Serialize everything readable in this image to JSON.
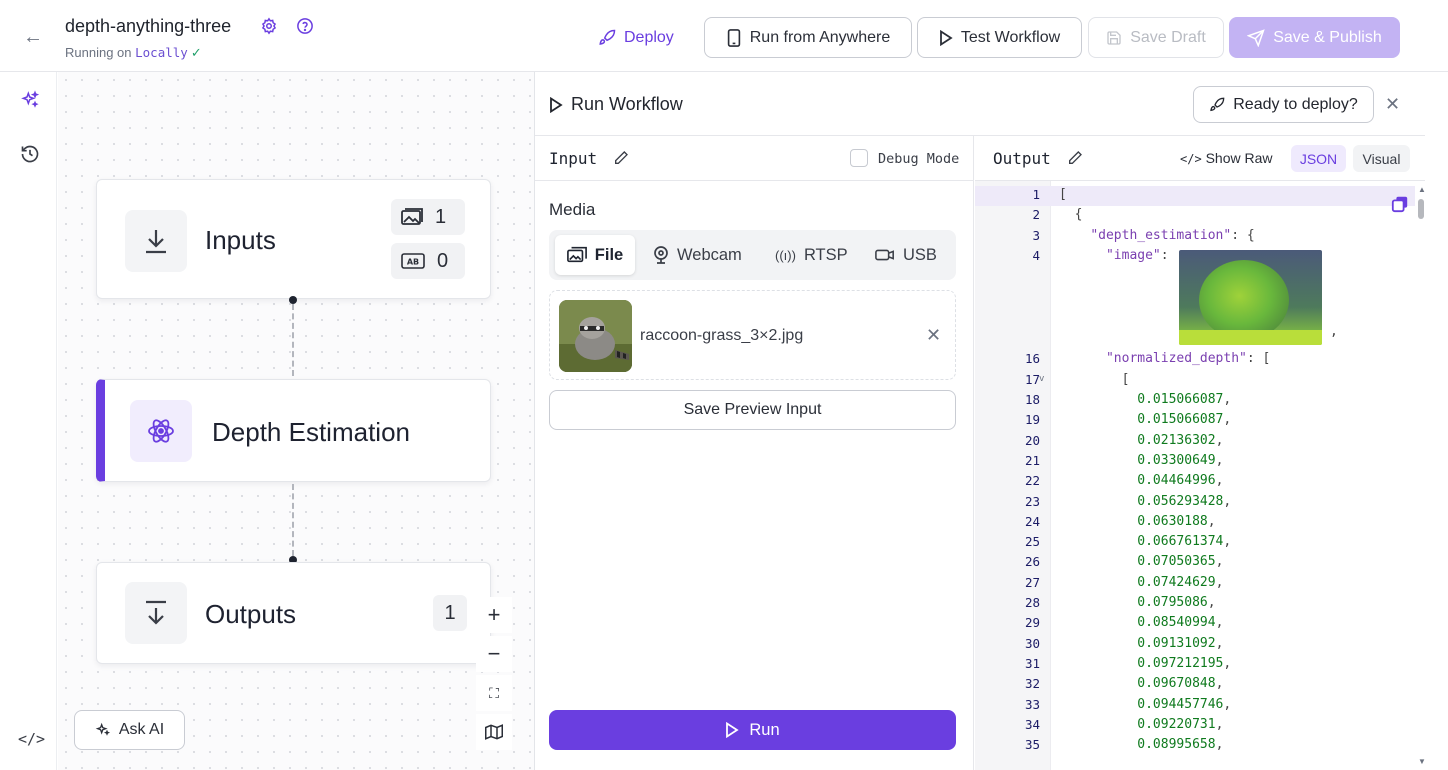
{
  "header": {
    "project_name": "depth-anything-three",
    "running_prefix": "Running on",
    "running_location": "Locally",
    "deploy_label": "Deploy",
    "run_anywhere_label": "Run from Anywhere",
    "test_workflow_label": "Test Workflow",
    "save_draft_label": "Save Draft",
    "save_publish_label": "Save & Publish"
  },
  "canvas": {
    "inputs_node": {
      "title": "Inputs",
      "image_count": "1",
      "text_count": "0"
    },
    "depth_node": {
      "title": "Depth Estimation"
    },
    "outputs_node": {
      "title": "Outputs",
      "count": "1"
    },
    "ask_ai_label": "Ask AI"
  },
  "panel": {
    "title": "Run Workflow",
    "ready_deploy_label": "Ready to deploy?",
    "input_label": "Input",
    "debug_label": "Debug Mode",
    "media_label": "Media",
    "media_tabs": [
      "File",
      "Webcam",
      "RTSP",
      "USB"
    ],
    "file_name": "raccoon-grass_3×2.jpg",
    "save_preview_label": "Save Preview Input",
    "run_label": "Run",
    "output_label": "Output",
    "show_raw_label": "Show Raw",
    "json_label": "JSON",
    "visual_label": "Visual"
  },
  "code": {
    "lines": [
      {
        "n": "1",
        "text": "["
      },
      {
        "n": "2",
        "text": "  {"
      },
      {
        "n": "3",
        "key": "\"depth_estimation\"",
        "rest": ": {",
        "indent": "    "
      },
      {
        "n": "4",
        "key": "\"image\"",
        "rest": ":",
        "indent": "      "
      },
      {
        "n": "16",
        "key": "\"normalized_depth\"",
        "rest": ": [",
        "indent": "      "
      },
      {
        "n": "17",
        "text": "        ["
      },
      {
        "n": "18",
        "num": "0.015066087"
      },
      {
        "n": "19",
        "num": "0.015066087"
      },
      {
        "n": "20",
        "num": "0.02136302"
      },
      {
        "n": "21",
        "num": "0.03300649"
      },
      {
        "n": "22",
        "num": "0.04464996"
      },
      {
        "n": "23",
        "num": "0.056293428"
      },
      {
        "n": "24",
        "num": "0.0630188"
      },
      {
        "n": "25",
        "num": "0.066761374"
      },
      {
        "n": "26",
        "num": "0.07050365"
      },
      {
        "n": "27",
        "num": "0.07424629"
      },
      {
        "n": "28",
        "num": "0.0795086"
      },
      {
        "n": "29",
        "num": "0.08540994"
      },
      {
        "n": "30",
        "num": "0.09131092"
      },
      {
        "n": "31",
        "num": "0.097212195"
      },
      {
        "n": "32",
        "num": "0.09670848"
      },
      {
        "n": "33",
        "num": "0.094457746"
      },
      {
        "n": "34",
        "num": "0.09220731"
      },
      {
        "n": "35",
        "num": "0.08995658"
      }
    ]
  }
}
